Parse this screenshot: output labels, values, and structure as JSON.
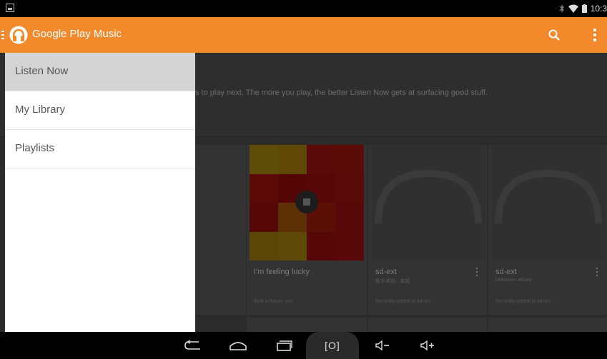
{
  "status_bar": {
    "time": "10:3",
    "icons": [
      "screenshot-notification-icon",
      "bluetooth-icon",
      "wifi-icon",
      "battery-icon"
    ]
  },
  "action_bar": {
    "title": "Google Play Music",
    "icons": [
      "headphones-logo-icon",
      "search-icon",
      "overflow-menu-icon"
    ],
    "color": "#f28a2c"
  },
  "drawer": {
    "items": [
      {
        "label": "Listen Now",
        "active": true
      },
      {
        "label": "My Library",
        "active": false
      },
      {
        "label": "Playlists",
        "active": false
      }
    ]
  },
  "main": {
    "hint_text": "s to play next. The more you play, the better Listen Now gets at surfacing good stuff.",
    "cards": [
      {
        "title": "I'm feeling lucky",
        "subtitle": "",
        "footer": "Built in Music mix"
      },
      {
        "title": "sd-ext",
        "subtitle": "歌手未知 · 未知",
        "footer": "Recently added to library"
      },
      {
        "title": "sd-ext",
        "subtitle": "Unknown album",
        "footer": "Recently added to library"
      }
    ]
  },
  "nav_bar": {
    "screenshot_label": "[O]",
    "icons": [
      "back-icon",
      "home-icon",
      "recents-icon",
      "screenshot-icon",
      "volume-down-icon",
      "volume-up-icon"
    ]
  }
}
